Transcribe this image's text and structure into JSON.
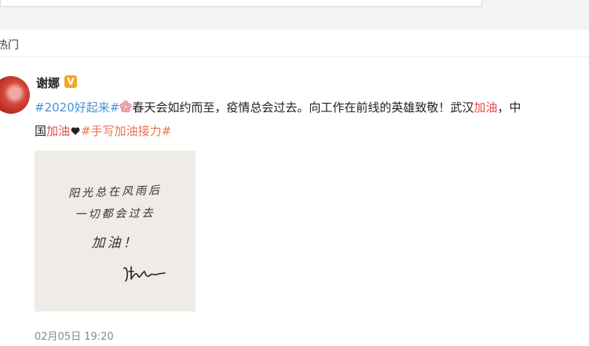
{
  "tabs": {
    "current": "热门"
  },
  "post": {
    "username": "谢娜",
    "verified_badge": "V",
    "line1": {
      "hashtag1": "#2020好起来#",
      "text1": "春天会如约而至，疫情总会过去。向工作在前线的英雄致敬！武汉",
      "red1": "加油",
      "text2": "，中"
    },
    "line2": {
      "text1": "国",
      "red1": "加油",
      "hashtag2": "#手写加油接力#"
    },
    "image": {
      "handwriting_line1": "阳光总在风雨后",
      "handwriting_line2": "一切都会过去",
      "handwriting_line3": "加油！"
    },
    "timestamp": "02月05日 19:20"
  },
  "colors": {
    "hashtag_orange": "#eb7350",
    "hashtag_blue": "#4a90d9",
    "highlight_red": "#e84a4a",
    "badge": "#f5a623"
  },
  "icons": [
    "cherry-blossom-icon",
    "black-heart-icon",
    "verified-v-icon"
  ]
}
